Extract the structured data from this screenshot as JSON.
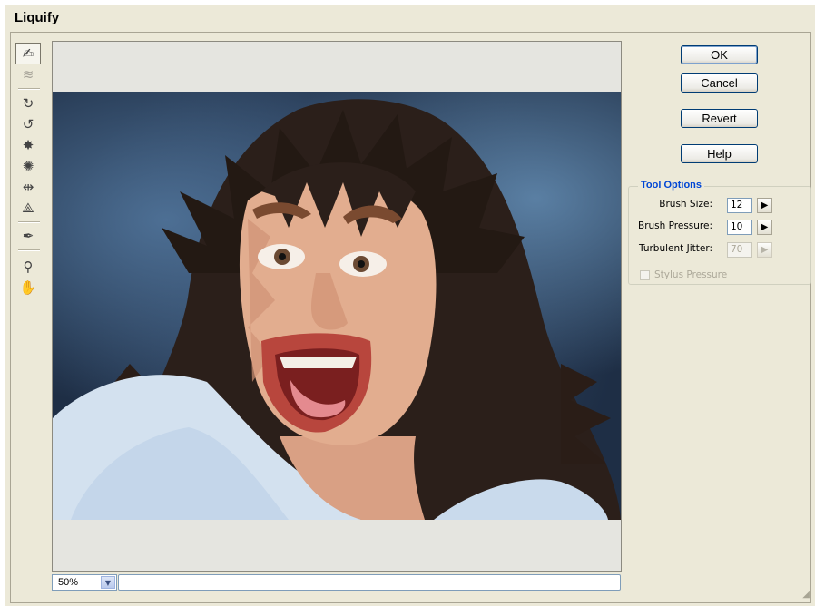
{
  "window": {
    "title": "Liquify"
  },
  "toolbar": {
    "tools": [
      {
        "name": "forward-warp-tool-icon",
        "glyph": "✍",
        "selected": true
      },
      {
        "name": "reconstruct-tool-icon",
        "glyph": "≋",
        "disabled": true
      },
      {
        "name": "twirl-clockwise-tool-icon",
        "glyph": "↻"
      },
      {
        "name": "twirl-counterclockwise-tool-icon",
        "glyph": "↺"
      },
      {
        "name": "pucker-tool-icon",
        "glyph": "✸"
      },
      {
        "name": "bloat-tool-icon",
        "glyph": "✺"
      },
      {
        "name": "push-left-tool-icon",
        "glyph": "⇹"
      },
      {
        "name": "mirror-tool-icon",
        "glyph": "⟁"
      },
      {
        "name": "turbulence-tool-icon",
        "glyph": "✒"
      },
      {
        "name": "zoom-tool-icon",
        "glyph": "🔍"
      },
      {
        "name": "hand-tool-icon",
        "glyph": "✋"
      }
    ]
  },
  "buttons": {
    "ok": "OK",
    "cancel": "Cancel",
    "revert": "Revert",
    "help": "Help"
  },
  "tool_options": {
    "legend": "Tool Options",
    "brush_size_label": "Brush Size:",
    "brush_size_value": "12",
    "brush_pressure_label": "Brush Pressure:",
    "brush_pressure_value": "10",
    "turbulent_jitter_label": "Turbulent Jitter:",
    "turbulent_jitter_value": "70",
    "stylus_pressure_label": "Stylus Pressure"
  },
  "bottom": {
    "zoom_value": "50%",
    "status_text": ""
  },
  "colors": {
    "accent": "#0046d5",
    "button_border": "#003c74",
    "dialog_bg": "#ece9d8"
  }
}
